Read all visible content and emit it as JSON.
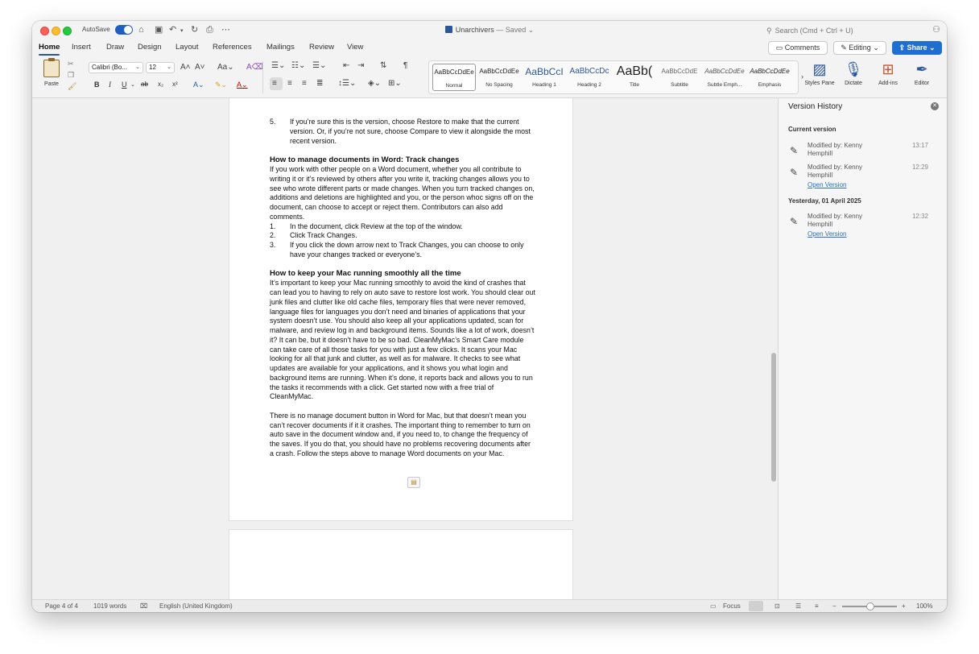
{
  "titlebar": {
    "autosave_label": "AutoSave",
    "doc_name": "Unarchivers",
    "doc_status": " — Saved",
    "search_placeholder": "Search (Cmd + Ctrl + U)"
  },
  "tabs": [
    "Home",
    "Insert",
    "Draw",
    "Design",
    "Layout",
    "References",
    "Mailings",
    "Review",
    "View"
  ],
  "actions": {
    "comments": "Comments",
    "editing": "Editing",
    "share": "Share"
  },
  "ribbon": {
    "paste": "Paste",
    "font_name": "Calibri (Bo...",
    "font_size": "12",
    "styles": [
      {
        "sample": "AaBbCcDdEe",
        "name": "Normal"
      },
      {
        "sample": "AaBbCcDdEe",
        "name": "No Spacing"
      },
      {
        "sample": "AaBbCcI",
        "name": "Heading 1"
      },
      {
        "sample": "AaBbCcDc",
        "name": "Heading 2"
      },
      {
        "sample": "AaBb(",
        "name": "Title"
      },
      {
        "sample": "AaBbCcDdE",
        "name": "Subtitle"
      },
      {
        "sample": "AaBbCcDdEe",
        "name": "Subtle Emph..."
      },
      {
        "sample": "AaBbCcDdEe",
        "name": "Emphasis"
      }
    ],
    "styles_pane": "Styles Pane",
    "dictate": "Dictate",
    "addins": "Add-ins",
    "editor": "Editor"
  },
  "document": {
    "step5_num": "5.",
    "step5": "If you’re sure this is the version, choose Restore to make that the current version. Or, if you’re not sure, choose Compare to view it alongside the most recent version.",
    "h_track": "How to manage documents in Word: Track changes",
    "p_track": "If you work with other people on a Word document, whether you all contribute to writing it or it’s reviewed by others after you write it, tracking changes allows you to see who wrote different parts or made changes. When you turn tracked changes on, additions and deletions are highlighted and you, or the person whoc signs off on the document, can choose to accept or reject them. Contributors can also add comments.",
    "track_steps": [
      {
        "num": "1.",
        "text": "In the document, click Review at the top of the window."
      },
      {
        "num": "2.",
        "text": "Click Track Changes."
      },
      {
        "num": "3.",
        "text": "If you click the down arrow next to Track Changes, you can choose to only have your changes tracked or everyone’s."
      }
    ],
    "h_mac": "How to keep your Mac running smoothly all the time",
    "p_mac": "It’s important to keep your Mac running smoothly to avoid the kind of crashes that can lead you to having to rely on auto save to restore lost work. You should clear out junk files and clutter like old cache files, temporary files that were never removed, language files for languages you don’t need and binaries of applications that your system doesn’t use. You should also keep all your applications updated, scan for malware, and review log in and background items. Sounds like a lot of work, doesn’t it? It can be, but it doesn’t have to be so bad. CleanMyMac’s Smart Care module can take care of all those tasks for you with just a few clicks. It scans your Mac looking for all that junk and clutter, as well as for malware. It checks to see what updates are available for your applications, and it shows you what login and background items are running. When it’s done, it reports back and allows you to run the tasks it recommends with a click. Get started now with a free trial of CleanMyMac.",
    "p_final": "There is no manage document button in Word for Mac, but that doesn’t mean you can’t recover documents if it it crashes. The important thing to remember to turn on auto save in the document window and, if you need to, to change the frequency of the saves. If you do that, you should have no problems recovering documents after a crash. Follow the steps above to manage Word documents on your Mac."
  },
  "version_history": {
    "title": "Version History",
    "current_label": "Current version",
    "yesterday_label": "Yesterday, 01 April 2025",
    "entries": [
      {
        "who": "Modified by: Kenny Hemphill",
        "time": "13:17"
      },
      {
        "who": "Modified by: Kenny Hemphill",
        "time": "12:29",
        "link": "Open Version"
      },
      {
        "who": "Modified by: Kenny Hemphill",
        "time": "12:32",
        "link": "Open Version"
      }
    ]
  },
  "statusbar": {
    "page": "Page 4 of 4",
    "words": "1019 words",
    "language": "English (United Kingdom)",
    "focus": "Focus",
    "zoom": "100%"
  },
  "colors": {
    "accent": "#2b579a",
    "share": "#1f6fd1",
    "link": "#2b6fbf"
  }
}
